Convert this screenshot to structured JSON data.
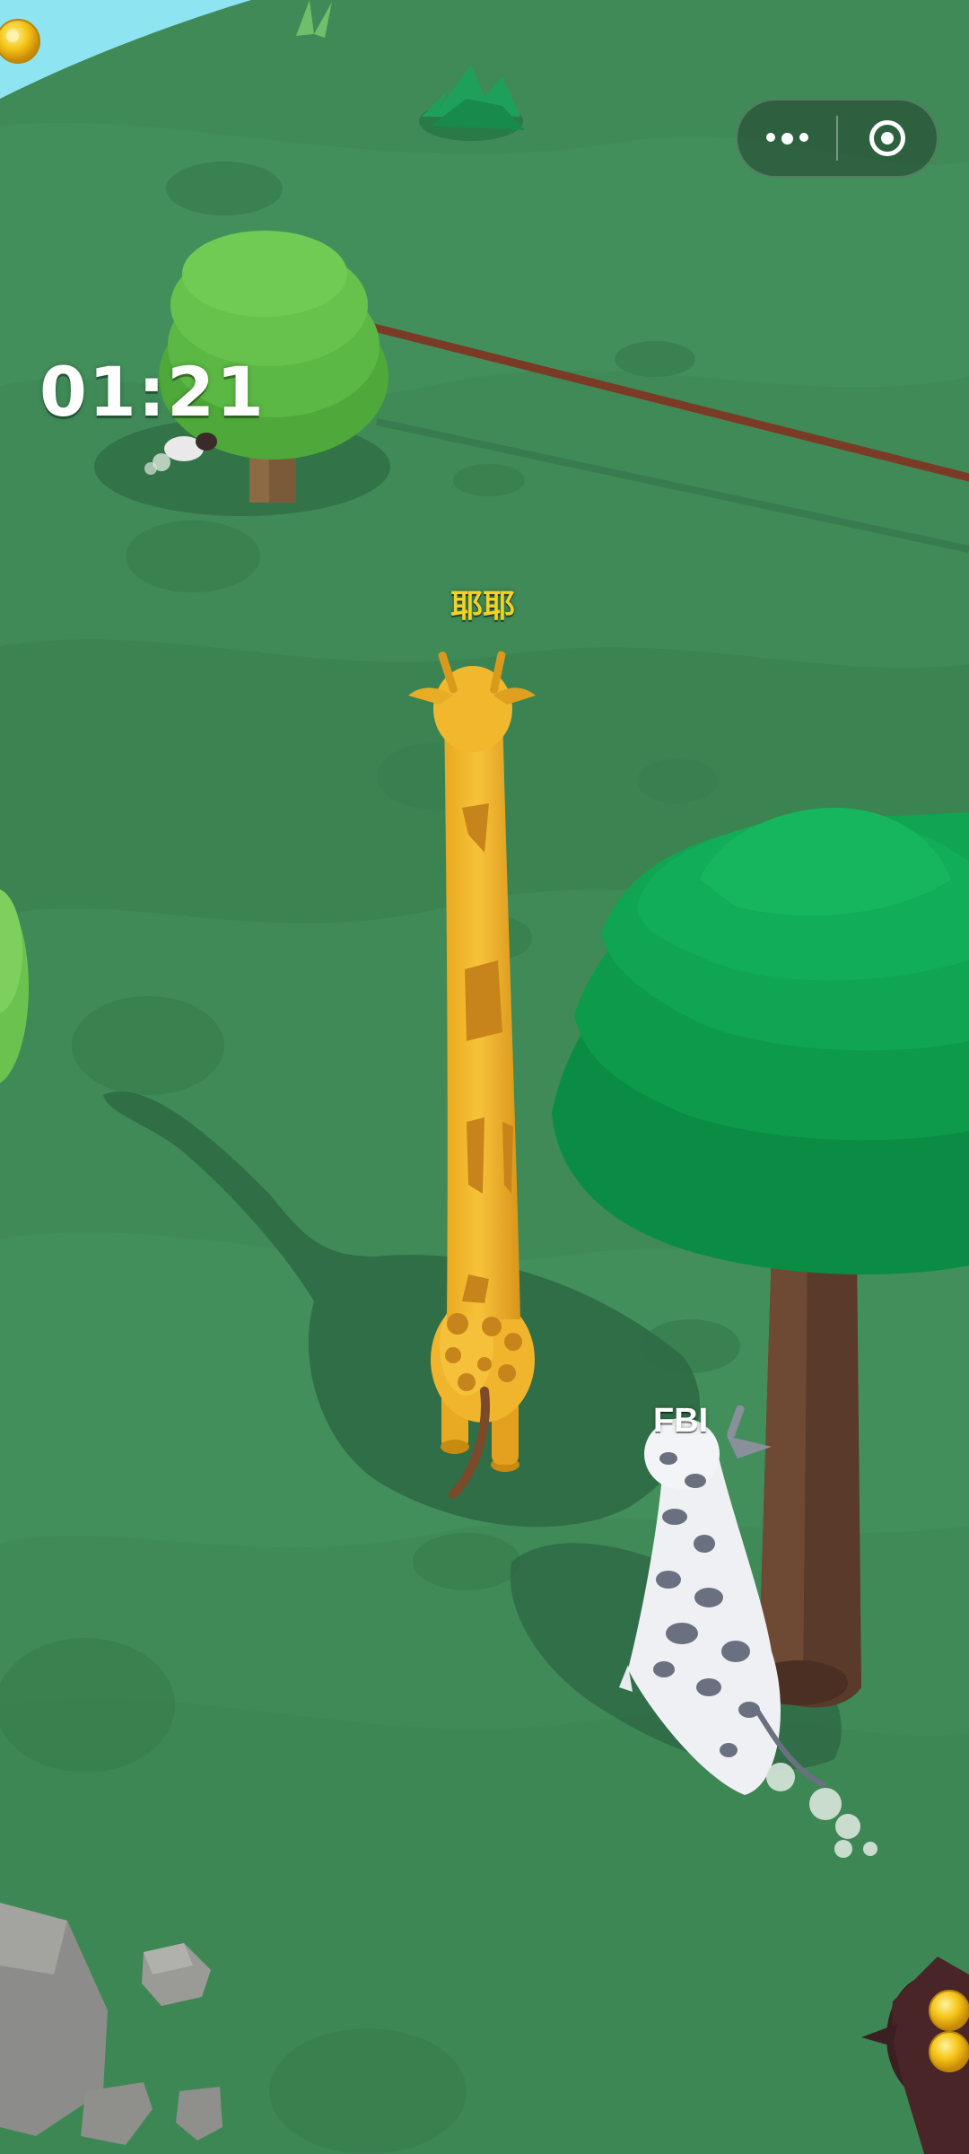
{
  "hud": {
    "timer": "01:21"
  },
  "players": {
    "main_name": "耶耶",
    "rival_name": "FBI"
  },
  "colors": {
    "grass": "#3f8a57",
    "giraffe_yellow": "#f2b429",
    "name_yellow": "#f5d027"
  },
  "icons": {
    "menu": "more-dots-icon",
    "close": "target-close-icon",
    "coin": "gold-coin-icon"
  }
}
